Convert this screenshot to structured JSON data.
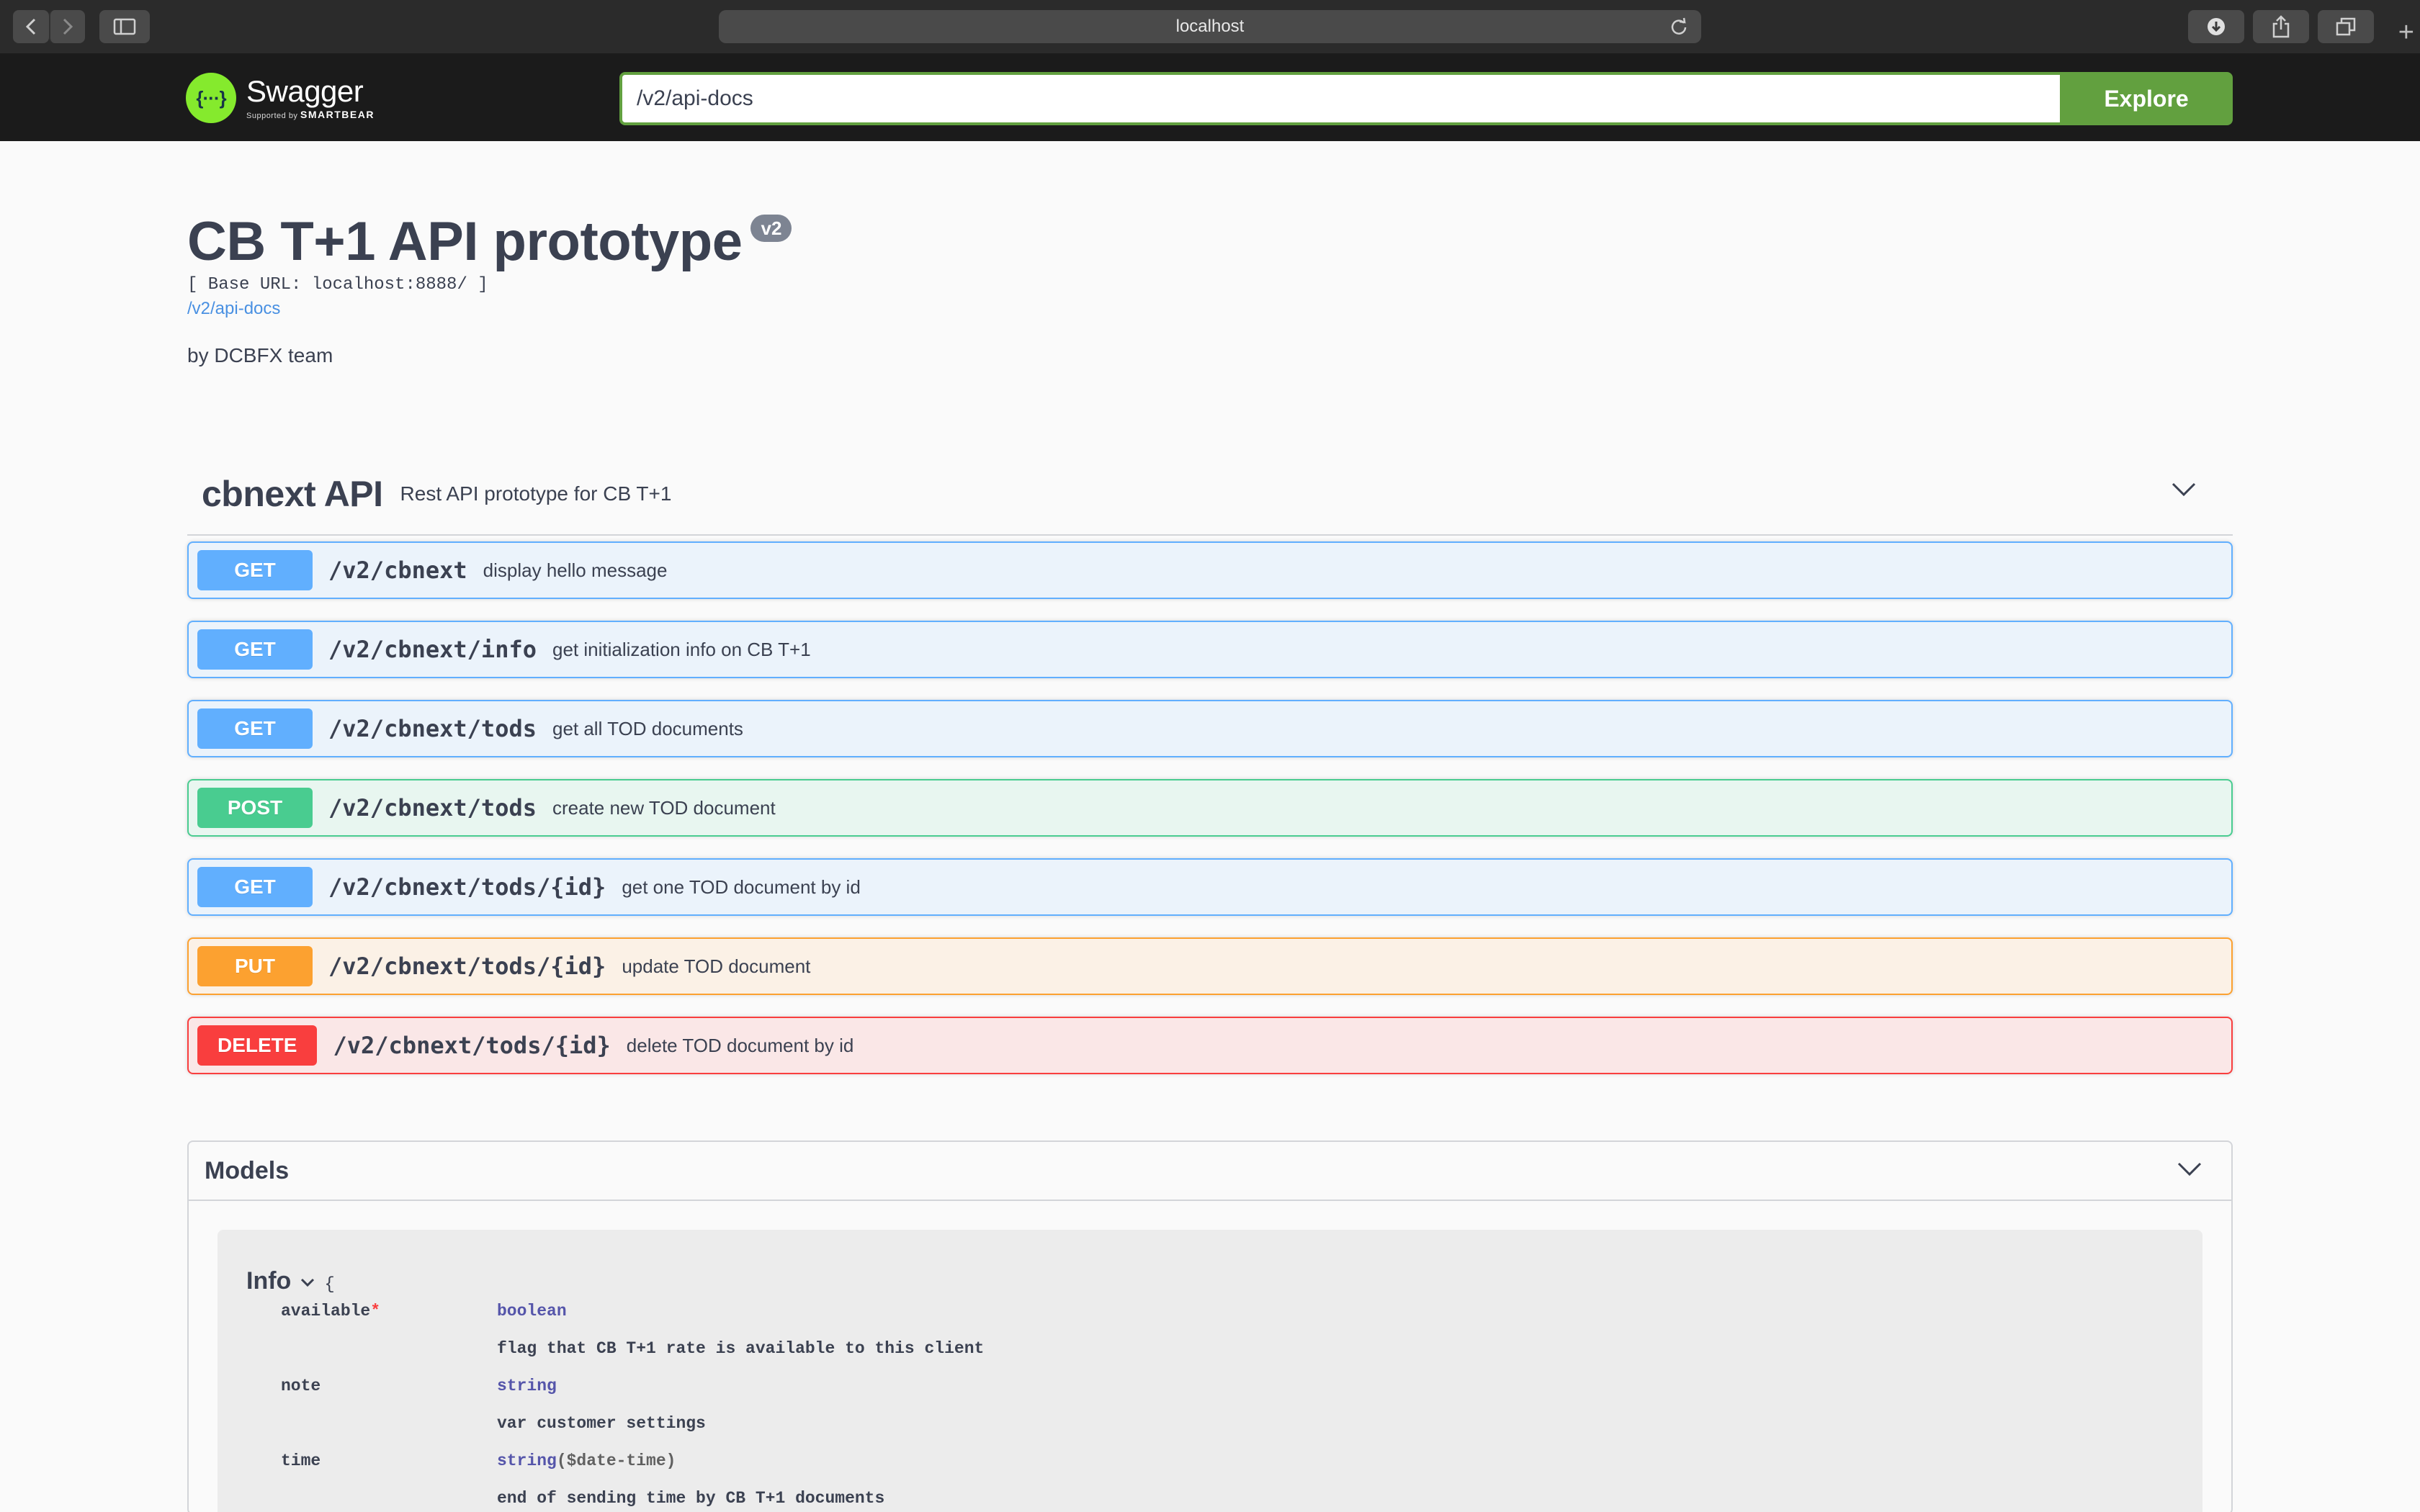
{
  "browser": {
    "address": "localhost"
  },
  "topbar": {
    "logo_symbol": "{···}",
    "logo_title": "Swagger",
    "logo_sub_prefix": "Supported by",
    "logo_sub_brand": "SMARTBEAR",
    "url_value": "/v2/api-docs",
    "explore_label": "Explore"
  },
  "info": {
    "title": "CB T+1 API prototype",
    "version": "v2",
    "base_url": "[ Base URL: localhost:8888/ ]",
    "spec_link": "/v2/api-docs",
    "author": "by DCBFX team"
  },
  "tag": {
    "name": "cbnext API",
    "description": "Rest API prototype for CB T+1"
  },
  "operations": [
    {
      "method": "GET",
      "path": "/v2/cbnext",
      "summary": "display hello message"
    },
    {
      "method": "GET",
      "path": "/v2/cbnext/info",
      "summary": "get initialization info on CB T+1"
    },
    {
      "method": "GET",
      "path": "/v2/cbnext/tods",
      "summary": "get all TOD documents"
    },
    {
      "method": "POST",
      "path": "/v2/cbnext/tods",
      "summary": "create new TOD document"
    },
    {
      "method": "GET",
      "path": "/v2/cbnext/tods/{id}",
      "summary": "get one TOD document by id"
    },
    {
      "method": "PUT",
      "path": "/v2/cbnext/tods/{id}",
      "summary": "update TOD document"
    },
    {
      "method": "DELETE",
      "path": "/v2/cbnext/tods/{id}",
      "summary": "delete TOD document by id"
    }
  ],
  "models": {
    "title": "Models",
    "model_name": "Info",
    "open_brace": "{",
    "properties": [
      {
        "name": "available",
        "required_mark": "*",
        "type": "boolean",
        "format": "",
        "description": "flag that CB T+1 rate is available to this client"
      },
      {
        "name": "note",
        "required_mark": "",
        "type": "string",
        "format": "",
        "description": "var customer settings"
      },
      {
        "name": "time",
        "required_mark": "",
        "type": "string",
        "format": "($date-time)",
        "description": "end of sending time by CB T+1 documents"
      }
    ]
  },
  "colors": {
    "get": "#61affe",
    "post": "#49cc90",
    "put": "#fca130",
    "delete": "#f93e3e",
    "explore": "#62a03f"
  }
}
